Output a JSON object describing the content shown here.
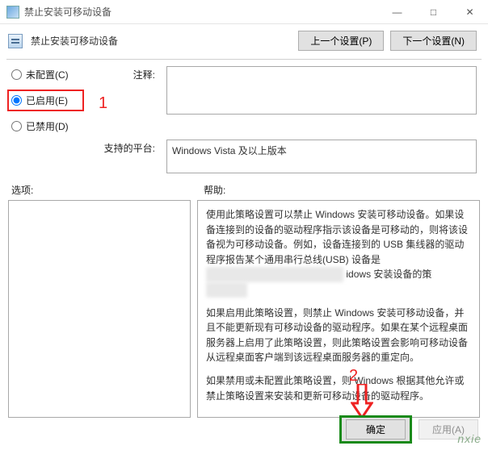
{
  "window": {
    "title": "禁止安装可移动设备",
    "minimize": "—",
    "maximize": "□",
    "close": "✕"
  },
  "header": {
    "title": "禁止安装可移动设备",
    "prev": "上一个设置(P)",
    "next": "下一个设置(N)"
  },
  "radios": {
    "not_configured": "未配置(C)",
    "enabled": "已启用(E)",
    "disabled": "已禁用(D)"
  },
  "labels": {
    "comment": "注释:",
    "platform": "支持的平台:",
    "options": "选项:",
    "help": "帮助:"
  },
  "platform_text": "Windows Vista 及以上版本",
  "help": {
    "p1a": "使用此策略设置可以禁止 Windows 安装可移动设备。如果设备连接到的设备的驱动程序指示该设备是可移动的，则将该设备视为可移动设备。例如，设备连接到的 USB 集线器的驱动程序报告某个通用串行总线(USB) 设备是",
    "p1b_blur": "████████████████████",
    "p1c": "idows 安装设备的策",
    "p1d_blur": "██████",
    "p2": "如果启用此策略设置，则禁止 Windows 安装可移动设备，并且不能更新现有可移动设备的驱动程序。如果在某个远程桌面服务器上启用了此策略设置，则此策略设置会影响可移动设备从远程桌面客户端到该远程桌面服务器的重定向。",
    "p3": "如果禁用或未配置此策略设置，则 Windows 根据其他允许或禁止策略设置来安装和更新可移动设备的驱动程序。"
  },
  "annotations": {
    "one": "1",
    "two": "2"
  },
  "buttons": {
    "ok": "确定",
    "apply": "应用(A)"
  },
  "watermark": "nxie"
}
